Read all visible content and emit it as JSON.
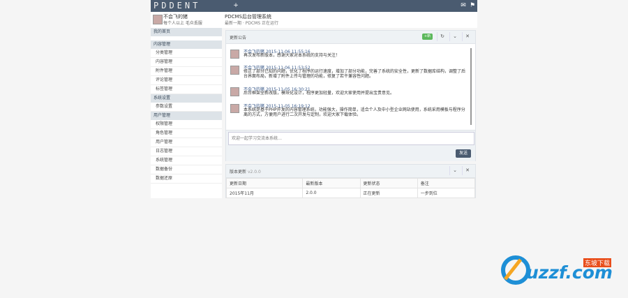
{
  "topbar": {
    "brand": "PDDENT",
    "add_icon": "plus-icon",
    "right_icons": [
      "mail-icon",
      "user-icon"
    ]
  },
  "user": {
    "name": "不会飞的猪",
    "subtitle": "每个人以上 毛众丢服"
  },
  "site": {
    "title": "PDCMS后台管理系统",
    "subtitle": "最新一期 · PDCMS 正在运行"
  },
  "sidebar": {
    "sections": [
      {
        "label": "我的首页",
        "items": []
      },
      {
        "label": "内容管理",
        "items": [
          "分类管理",
          "内容管理",
          "附件管理",
          "评论管理",
          "标签管理"
        ]
      },
      {
        "label": "系统设置",
        "items": [
          "参数设置"
        ]
      },
      {
        "label": "用户管理",
        "items": [
          "权限管理",
          "角色管理",
          "用户管理",
          "日志管理",
          "系统管理",
          "数据备份",
          "数据还原"
        ]
      }
    ]
  },
  "chat": {
    "title": "更新公告",
    "badge": "+新",
    "messages": [
      {
        "author": "不会飞的猪",
        "time": "2015-11-06 11:55:16",
        "text": "再次发布新版本，感谢大家对本系统的支持与关注！"
      },
      {
        "author": "不会飞的猪",
        "time": "2015-11-06 11:53:52",
        "text": "修正了部分已知的问题，优化了程序的运行速度，增加了部分功能，完善了系统的安全性，更新了数据库结构，调整了后台界面布局，新增了附件上传与管理的功能，修复了若干兼容性问题。"
      },
      {
        "author": "不会飞的猪",
        "time": "2015-11-05 16:30:21",
        "text": "后台框架全新改版，模块化设计，程序更加轻量，欢迎大家使用并提出宝贵意见。"
      },
      {
        "author": "不会飞的猪",
        "time": "2015-11-05 16:19:12",
        "text": "本系统是基于PHP开发的内容管理系统，功能强大，操作简单，适合个人及中小型企业网站使用，系统采用模板与程序分离的方式，方便用户进行二次开发与定制，欢迎大家下载体验。"
      }
    ],
    "input_placeholder": "欢迎一起学习交流本系统…",
    "send_label": "发送"
  },
  "version": {
    "title": "版本更新",
    "version_label": "v2.0.0",
    "columns": [
      "更新日期",
      "最新版本",
      "更新状态",
      "备注"
    ],
    "rows": [
      [
        "2015年11月",
        "2.0.0",
        "正在更新",
        "一步到位"
      ]
    ]
  },
  "watermark": {
    "text": "uzzf.com",
    "tag": "东坡下载"
  },
  "colors": {
    "topbar": "#4a5b70",
    "badge": "#5cb85c",
    "send": "#4a5b70"
  }
}
